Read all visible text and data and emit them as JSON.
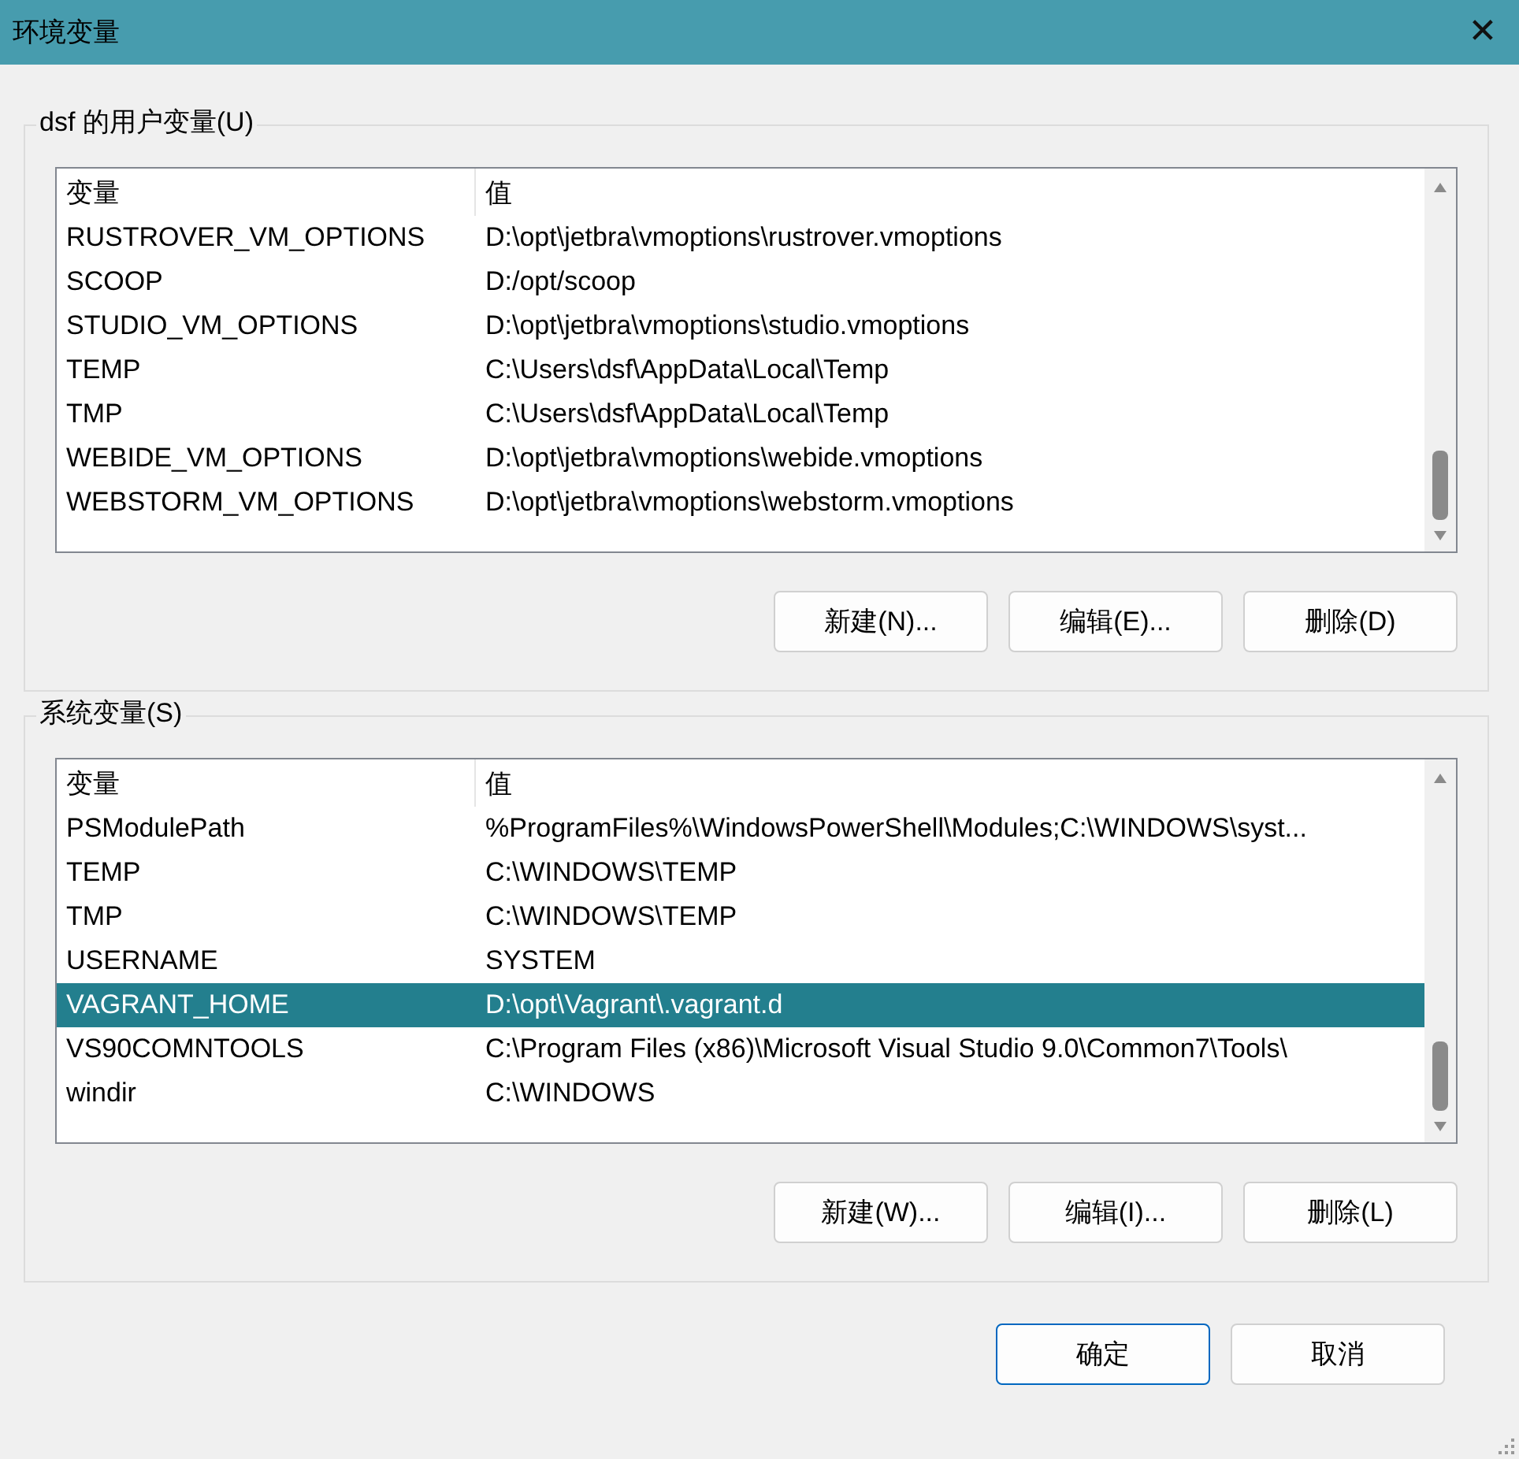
{
  "window": {
    "title": "环境变量",
    "close": "✕"
  },
  "groups": [
    {
      "title": "dsf 的用户变量(U)",
      "columns": [
        "变量",
        "值"
      ],
      "rows": [
        {
          "name": "RUSTROVER_VM_OPTIONS",
          "value": "D:\\opt\\jetbra\\vmoptions\\rustrover.vmoptions",
          "selected": false
        },
        {
          "name": "SCOOP",
          "value": "D:/opt/scoop",
          "selected": false
        },
        {
          "name": "STUDIO_VM_OPTIONS",
          "value": "D:\\opt\\jetbra\\vmoptions\\studio.vmoptions",
          "selected": false
        },
        {
          "name": "TEMP",
          "value": "C:\\Users\\dsf\\AppData\\Local\\Temp",
          "selected": false
        },
        {
          "name": "TMP",
          "value": "C:\\Users\\dsf\\AppData\\Local\\Temp",
          "selected": false
        },
        {
          "name": "WEBIDE_VM_OPTIONS",
          "value": "D:\\opt\\jetbra\\vmoptions\\webide.vmoptions",
          "selected": false
        },
        {
          "name": "WEBSTORM_VM_OPTIONS",
          "value": "D:\\opt\\jetbra\\vmoptions\\webstorm.vmoptions",
          "selected": false
        }
      ],
      "buttons": [
        "新建(N)...",
        "编辑(E)...",
        "删除(D)"
      ]
    },
    {
      "title": "系统变量(S)",
      "columns": [
        "变量",
        "值"
      ],
      "rows": [
        {
          "name": "PSModulePath",
          "value": "%ProgramFiles%\\WindowsPowerShell\\Modules;C:\\WINDOWS\\syst...",
          "selected": false
        },
        {
          "name": "TEMP",
          "value": "C:\\WINDOWS\\TEMP",
          "selected": false
        },
        {
          "name": "TMP",
          "value": "C:\\WINDOWS\\TEMP",
          "selected": false
        },
        {
          "name": "USERNAME",
          "value": "SYSTEM",
          "selected": false
        },
        {
          "name": "VAGRANT_HOME",
          "value": "D:\\opt\\Vagrant\\.vagrant.d",
          "selected": true
        },
        {
          "name": "VS90COMNTOOLS",
          "value": "C:\\Program Files (x86)\\Microsoft Visual Studio 9.0\\Common7\\Tools\\",
          "selected": false
        },
        {
          "name": "windir",
          "value": "C:\\WINDOWS",
          "selected": false
        }
      ],
      "buttons": [
        "新建(W)...",
        "编辑(I)...",
        "删除(L)"
      ]
    }
  ],
  "footer_buttons": [
    {
      "label": "确定",
      "default": true
    },
    {
      "label": "取消",
      "default": false
    }
  ]
}
